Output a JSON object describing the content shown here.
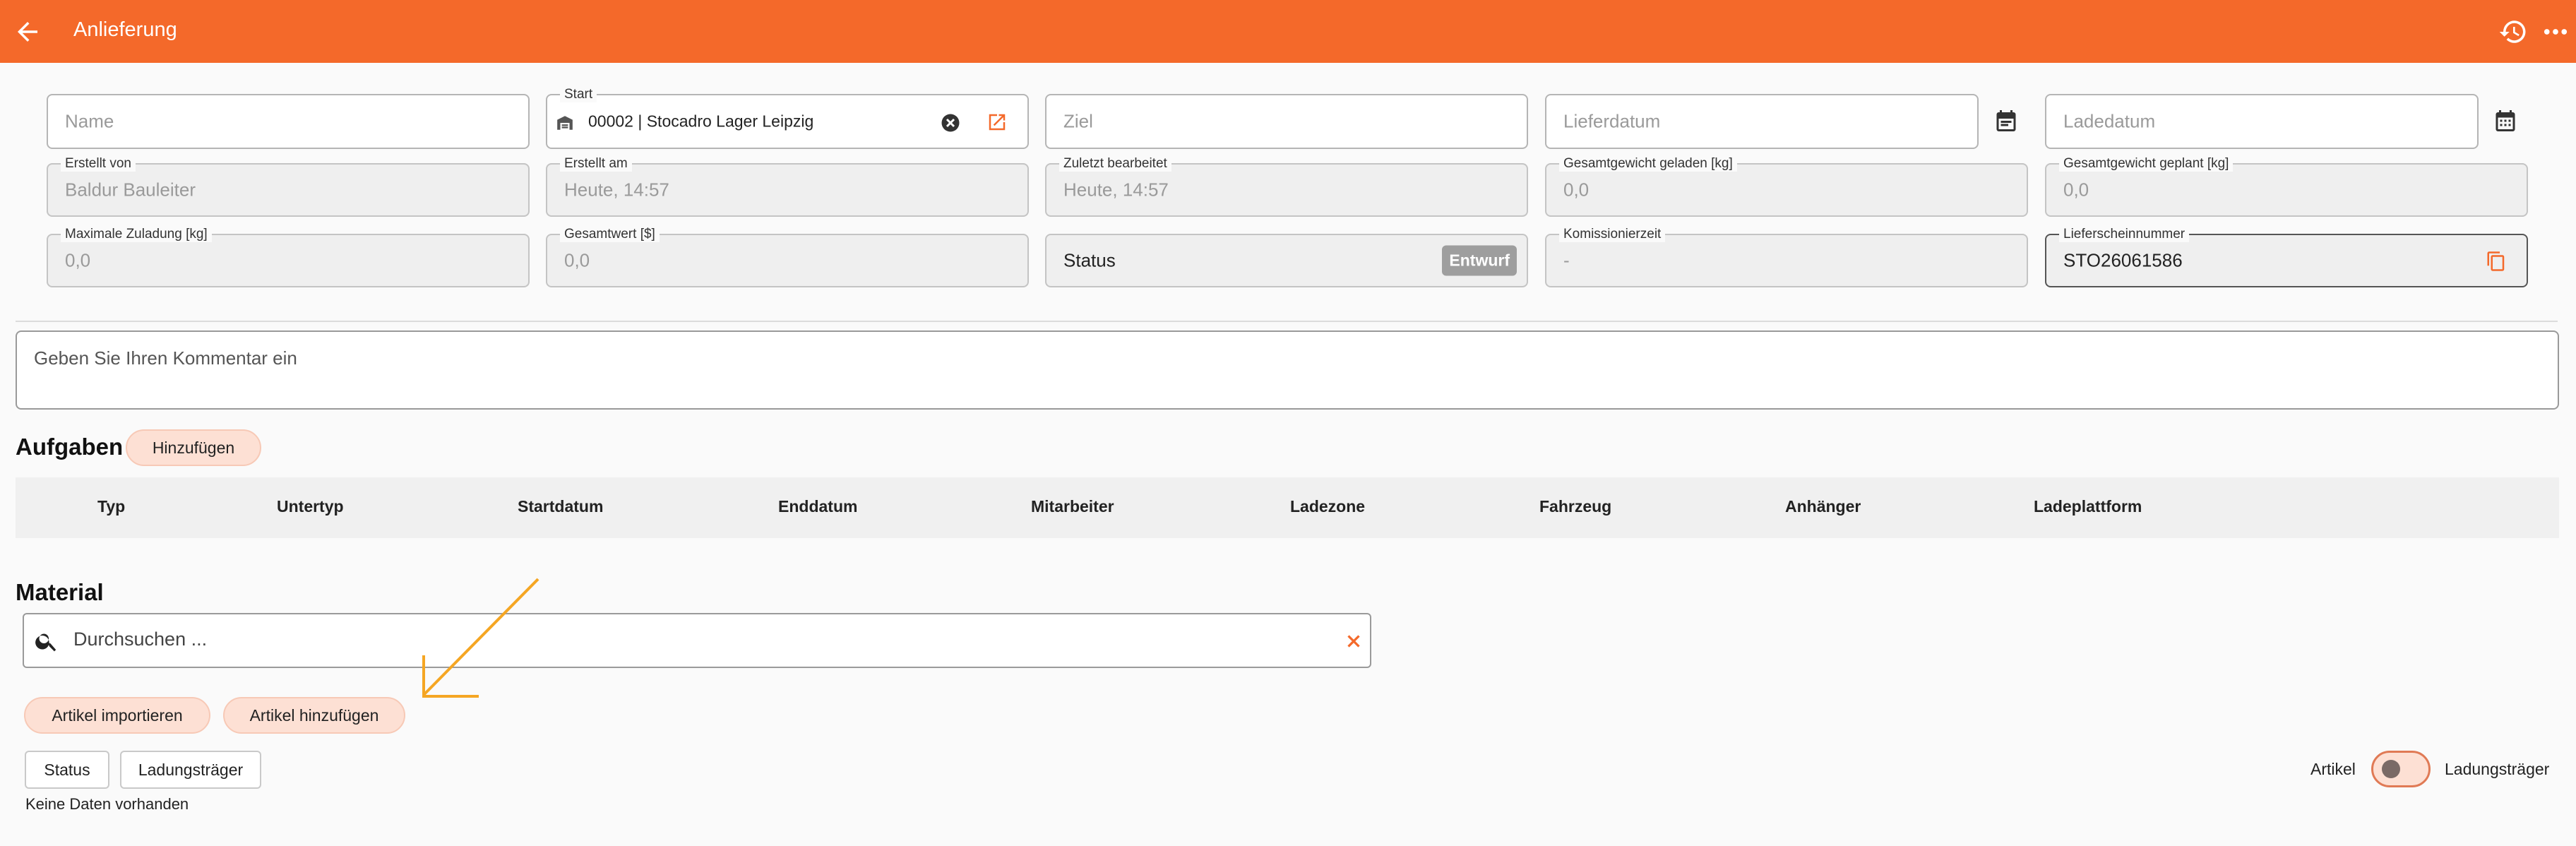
{
  "header": {
    "title": "Anlieferung",
    "back_icon": "arrow-left-icon",
    "history_icon": "history-icon",
    "more_icon": "more-horizontal-icon",
    "bg_color": "#f4692a"
  },
  "form": {
    "name": {
      "placeholder": "Name"
    },
    "start": {
      "label": "Start",
      "value": "00002 | Stocadro Lager Leipzig"
    },
    "ziel": {
      "placeholder": "Ziel"
    },
    "lieferdatum": {
      "placeholder": "Lieferdatum"
    },
    "ladedatum": {
      "placeholder": "Ladedatum"
    },
    "erstellt_von": {
      "label": "Erstellt von",
      "value": "Baldur Bauleiter"
    },
    "erstellt_am": {
      "label": "Erstellt am",
      "value": "Heute, 14:57"
    },
    "zuletzt": {
      "label": "Zuletzt bearbeitet",
      "value": "Heute, 14:57"
    },
    "gewicht_geladen": {
      "label": "Gesamtgewicht geladen [kg]",
      "value": "0,0"
    },
    "gewicht_geplant": {
      "label": "Gesamtgewicht geplant [kg]",
      "value": "0,0"
    },
    "max_zuladung": {
      "label": "Maximale Zuladung [kg]",
      "value": "0,0"
    },
    "gesamtwert": {
      "label": "Gesamtwert [$]",
      "value": "0,0"
    },
    "status": {
      "label": "Status",
      "badge": "Entwurf"
    },
    "kommission": {
      "label": "Komissionierzeit",
      "value": "-"
    },
    "lieferschein": {
      "label": "Lieferscheinnummer",
      "value": "STO26061586"
    }
  },
  "comment": {
    "placeholder": "Geben Sie Ihren Kommentar ein"
  },
  "aufgaben": {
    "title": "Aufgaben",
    "add_label": "Hinzufügen",
    "columns": [
      "Typ",
      "Untertyp",
      "Startdatum",
      "Enddatum",
      "Mitarbeiter",
      "Ladezone",
      "Fahrzeug",
      "Anhänger",
      "Ladeplattform"
    ]
  },
  "material": {
    "title": "Material",
    "search_placeholder": "Durchsuchen ...",
    "import_label": "Artikel importieren",
    "add_label": "Artikel hinzufügen",
    "filter_status": "Status",
    "filter_ladungstraeger": "Ladungsträger",
    "no_data": "Keine Daten vorhanden",
    "toggle_left": "Artikel",
    "toggle_right": "Ladungsträger"
  },
  "colors": {
    "accent": "#f4692a",
    "pill_bg": "#fde0d4",
    "annotation_arrow": "#f5a623"
  }
}
